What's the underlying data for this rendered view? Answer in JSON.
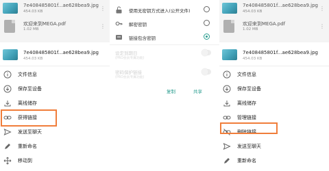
{
  "left": {
    "bg_files": [
      {
        "name": "7e408485801f...ae628bea9.jpg",
        "size": "454.03 KB"
      },
      {
        "name": "欢迎来到MEGA.pdf",
        "size": "1.02 MB"
      }
    ],
    "sheet_file": {
      "name": "7e408485801f...ae628bea9.jpg",
      "size": "454.03 KB"
    },
    "menu": [
      {
        "label": "文件信息",
        "icon": "info-icon"
      },
      {
        "label": "保存至设备",
        "icon": "download-icon"
      },
      {
        "label": "离线储存",
        "icon": "offline-download-icon"
      },
      {
        "label": "获得链接",
        "icon": "link-icon",
        "highlighted": true
      },
      {
        "label": "发送至聊天",
        "icon": "send-icon"
      },
      {
        "label": "重新命名",
        "icon": "pencil-icon"
      },
      {
        "label": "移动到",
        "icon": "move-icon"
      }
    ]
  },
  "middle": {
    "options": [
      {
        "label": "使用无密钥方式进入(公开文件)",
        "icon": "unlock-icon",
        "selected": false
      },
      {
        "label": "解密密钥",
        "icon": "key-icon",
        "selected": false
      },
      {
        "label": "链接包含密钥",
        "icon": "link-lock-icon",
        "selected": true
      }
    ],
    "toggles": [
      {
        "title": "设定到期日",
        "subtitle": "(PRO会员专属功能)"
      },
      {
        "title": "密码保护链接",
        "subtitle": "(PRO会员专属功能)"
      }
    ],
    "actions": {
      "copy": "复制",
      "share": "共享"
    },
    "accent": "#2a9d8f"
  },
  "right": {
    "bg_files": [
      {
        "name": "7e408485801f...ae628bea9.jpg",
        "size": "454.03 KB"
      },
      {
        "name": "欢迎来到MEGA.pdf",
        "size": "1.02 MB"
      }
    ],
    "sheet_file": {
      "name": "7e408485801f...ae628bea9.jpg",
      "size": "454.03 KB"
    },
    "menu": [
      {
        "label": "文件信息",
        "icon": "info-icon"
      },
      {
        "label": "保存至设备",
        "icon": "download-icon"
      },
      {
        "label": "离线储存",
        "icon": "offline-download-icon"
      },
      {
        "label": "管理链接",
        "icon": "link-icon"
      },
      {
        "label": "删除链接",
        "icon": "link-off-icon",
        "highlighted": true
      },
      {
        "label": "发送至聊天",
        "icon": "send-icon"
      },
      {
        "label": "重新命名",
        "icon": "pencil-icon"
      }
    ]
  },
  "highlight_color": "#f07d3a"
}
